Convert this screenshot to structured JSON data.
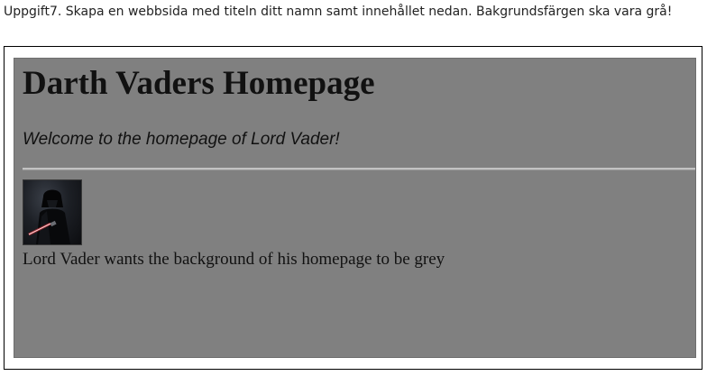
{
  "instructions": {
    "text": "Uppgift7. Skapa en webbsida med titeln ditt namn samt innehållet nedan. Bakgrundsfärgen ska vara grå!"
  },
  "web_page": {
    "heading": "Darth Vaders Homepage",
    "welcome": "Welcome to the homepage of Lord Vader!",
    "caption": "Lord Vader wants the background of his homepage to be grey",
    "background_color": "#808080"
  },
  "colors": {
    "lightsaber": "#e8323c"
  }
}
